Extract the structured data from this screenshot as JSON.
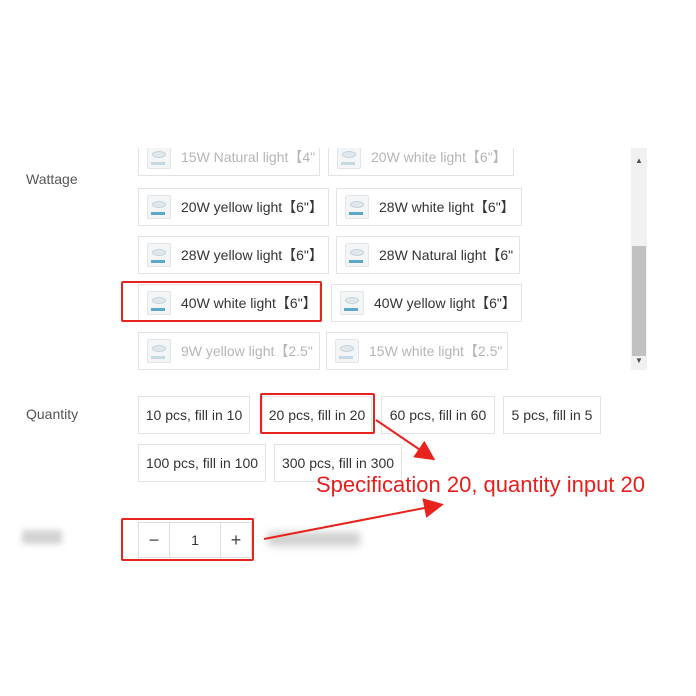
{
  "wattage": {
    "label": "Wattage",
    "options": [
      {
        "text": "15W Natural light【4\"",
        "disabled": true
      },
      {
        "text": "20W white light【6\"】",
        "disabled": true
      },
      {
        "text": "20W yellow light【6\"】",
        "disabled": false
      },
      {
        "text": "28W white light【6\"】",
        "disabled": false
      },
      {
        "text": "28W yellow light【6\"】",
        "disabled": false
      },
      {
        "text": "28W Natural light【6\"",
        "disabled": false
      },
      {
        "text": "40W white light【6\"】",
        "disabled": false,
        "highlighted": true
      },
      {
        "text": "40W yellow light【6\"】",
        "disabled": false
      },
      {
        "text": "9W yellow light【2.5\"",
        "disabled": true
      },
      {
        "text": "15W white light【2.5\"",
        "disabled": true
      }
    ]
  },
  "quantity": {
    "label": "Quantity",
    "options": [
      {
        "text": "10 pcs, fill in 10"
      },
      {
        "text": "20 pcs, fill in 20",
        "highlighted": true
      },
      {
        "text": "60 pcs, fill in 60"
      },
      {
        "text": "5 pcs, fill in 5"
      },
      {
        "text": "100 pcs, fill in 100"
      },
      {
        "text": "300 pcs, fill in 300"
      }
    ]
  },
  "stepper": {
    "minus": "−",
    "value": "1",
    "plus": "+"
  },
  "scrollbar": {
    "up_icon": "▲",
    "down_icon": "▼"
  },
  "annotation": {
    "text": "Specification 20, quantity input 20",
    "color": "#e8231e"
  }
}
